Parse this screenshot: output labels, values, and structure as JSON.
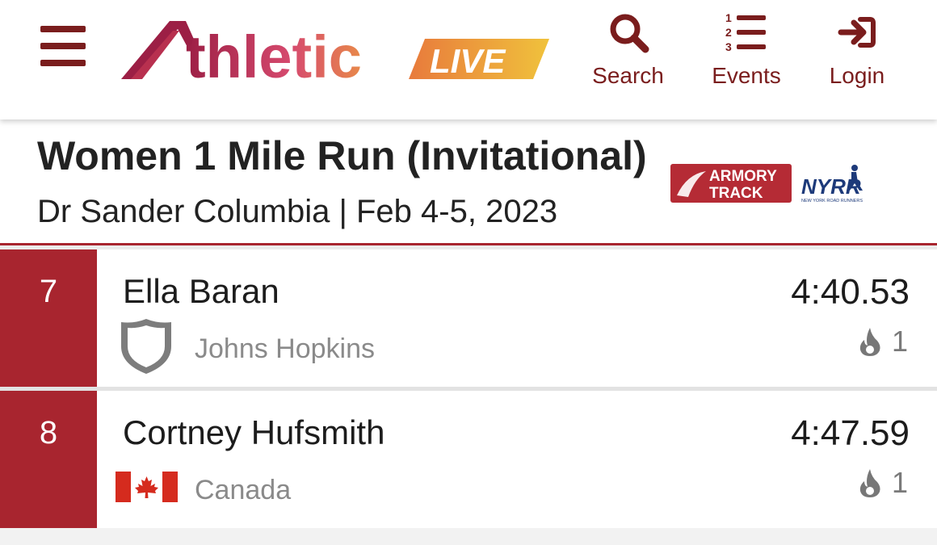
{
  "header": {
    "logo": {
      "main_text": "thletic",
      "badge_text": "LIVE"
    },
    "nav": {
      "search_label": "Search",
      "events_label": "Events",
      "login_label": "Login"
    },
    "colors": {
      "primary": "#7a1d1d",
      "accent_red": "#a8252f"
    }
  },
  "event": {
    "title": "Women 1 Mile Run (Invitational)",
    "subtitle": "Dr Sander Columbia | Feb 4-5, 2023",
    "sponsors": [
      {
        "name": "ARMORY TRACK",
        "line1": "ARMORY",
        "line2": "TRACK"
      },
      {
        "name": "NYRR",
        "tagline": "NEW YORK ROAD RUNNERS"
      }
    ]
  },
  "results": [
    {
      "place": "7",
      "athlete": "Ella Baran",
      "team": "Johns Hopkins",
      "team_icon": "shield-icon",
      "mark": "4:40.53",
      "heat": "1",
      "heat_icon": "flame-icon"
    },
    {
      "place": "8",
      "athlete": "Cortney Hufsmith",
      "team": "Canada",
      "team_icon": "canada-flag-icon",
      "mark": "4:47.59",
      "heat": "1",
      "heat_icon": "flame-icon"
    }
  ]
}
